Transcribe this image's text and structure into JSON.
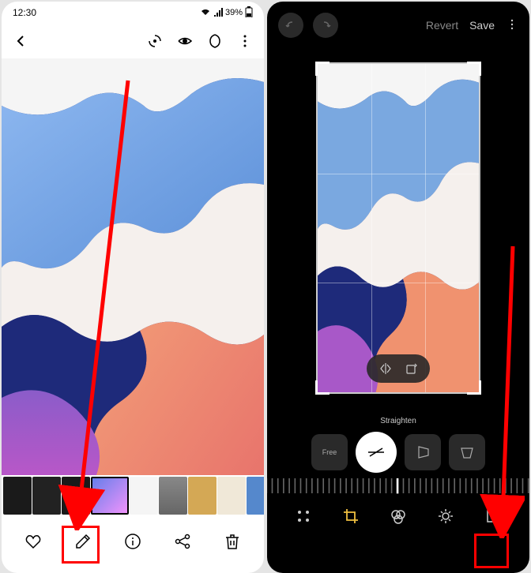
{
  "left": {
    "status": {
      "time": "12:30",
      "battery": "39%"
    },
    "bottom_icons": [
      "heart-icon",
      "pencil-icon",
      "info-icon",
      "share-icon",
      "trash-icon"
    ]
  },
  "right": {
    "actions": {
      "revert": "Revert",
      "save": "Save"
    },
    "transform_label": "Straighten",
    "free_label": "Free",
    "bottom_icons": [
      "grid-icon",
      "crop-icon",
      "filter-icon",
      "brightness-icon",
      "sticker-icon"
    ]
  }
}
